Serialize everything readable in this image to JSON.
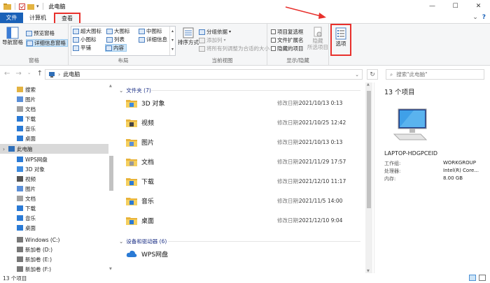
{
  "titlebar": {
    "title": "此电脑",
    "minimize": "—",
    "maximize": "☐",
    "close": "✕"
  },
  "tabs": {
    "file": "文件",
    "computer": "计算机",
    "view": "查看",
    "help_icon": "?"
  },
  "ribbon": {
    "pane_group": {
      "nav_pane": "导航窗格",
      "preview_pane": "预览窗格",
      "details_pane": "详细信息窗格",
      "label": "窗格"
    },
    "layout_group": {
      "items": [
        "超大图标",
        "大图标",
        "中图标",
        "小图标",
        "列表",
        "详细信息",
        "平铺",
        "内容"
      ],
      "label": "布局"
    },
    "current_view_group": {
      "sort_by": "排序方式",
      "group_by": "分组依据",
      "add_columns": "添加列",
      "fit_columns": "将所有列调整为合适的大小",
      "label": "当前视图"
    },
    "show_hide_group": {
      "item_checkboxes": "项目复选框",
      "file_extensions": "文件扩展名",
      "hidden_items": "隐藏的项目",
      "hide_selected_line1": "隐藏",
      "hide_selected_line2": "所选项目",
      "label": "显示/隐藏"
    },
    "options": "选项"
  },
  "address": {
    "path": "此电脑",
    "search_placeholder": "搜索\"此电脑\""
  },
  "nav_items": [
    {
      "label": "搜索",
      "icon": "folder-icon",
      "color": "#e3b341"
    },
    {
      "label": "图片",
      "icon": "pictures-icon",
      "color": "#5a8fd8"
    },
    {
      "label": "文档",
      "icon": "documents-icon",
      "color": "#a0a0a0"
    },
    {
      "label": "下载",
      "icon": "download-icon",
      "color": "#2a7ad5"
    },
    {
      "label": "音乐",
      "icon": "music-icon",
      "color": "#2a7ad5"
    },
    {
      "label": "桌面",
      "icon": "desktop-icon",
      "color": "#2a7ad5"
    },
    {
      "label": "此电脑",
      "icon": "computer-icon",
      "color": "#2f6fb8"
    },
    {
      "label": "WPS网盘",
      "icon": "cloud-icon",
      "color": "#2a7ad5"
    },
    {
      "label": "3D 对象",
      "icon": "3d-objects-icon",
      "color": "#3d8be0"
    },
    {
      "label": "视频",
      "icon": "videos-icon",
      "color": "#555555"
    },
    {
      "label": "图片",
      "icon": "pictures-icon",
      "color": "#5a8fd8"
    },
    {
      "label": "文档",
      "icon": "documents-icon",
      "color": "#a0a0a0"
    },
    {
      "label": "下载",
      "icon": "download-icon",
      "color": "#2a7ad5"
    },
    {
      "label": "音乐",
      "icon": "music-icon",
      "color": "#2a7ad5"
    },
    {
      "label": "桌面",
      "icon": "desktop-icon",
      "color": "#2a7ad5"
    },
    {
      "label": "Windows (C:)",
      "icon": "drive-icon",
      "color": "#777777"
    },
    {
      "label": "新加卷 (D:)",
      "icon": "drive-icon",
      "color": "#777777"
    },
    {
      "label": "新加卷 (E:)",
      "icon": "drive-icon",
      "color": "#777777"
    },
    {
      "label": "新加卷 (F:)",
      "icon": "drive-icon",
      "color": "#777777"
    }
  ],
  "folders_section": {
    "title": "文件夹 (7)"
  },
  "folders": [
    {
      "name": "3D 对象",
      "modified_label": "修改日期:",
      "modified": "2021/10/13 0:13",
      "badge": "3d"
    },
    {
      "name": "视频",
      "modified_label": "修改日期:",
      "modified": "2021/10/25 12:42",
      "badge": "video"
    },
    {
      "name": "图片",
      "modified_label": "修改日期:",
      "modified": "2021/10/13 0:13",
      "badge": "picture"
    },
    {
      "name": "文档",
      "modified_label": "修改日期:",
      "modified": "2021/11/29 17:57",
      "badge": "doc"
    },
    {
      "name": "下载",
      "modified_label": "修改日期:",
      "modified": "2021/12/10 11:17",
      "badge": "download"
    },
    {
      "name": "音乐",
      "modified_label": "修改日期:",
      "modified": "2021/11/5 14:00",
      "badge": "music"
    },
    {
      "name": "桌面",
      "modified_label": "修改日期:",
      "modified": "2021/12/10 9:04",
      "badge": "desktop"
    }
  ],
  "devices_section": {
    "title": "设备和驱动器 (6)"
  },
  "devices": [
    {
      "name": "WPS网盘"
    }
  ],
  "details": {
    "count": "13 个项目",
    "computer_name": "LAPTOP-HDGPCEID",
    "props": [
      {
        "label": "工作组:",
        "value": "WORKGROUP"
      },
      {
        "label": "处理器:",
        "value": "Intel(R) Core..."
      },
      {
        "label": "内存:",
        "value": "8.00 GB"
      }
    ]
  },
  "status": {
    "text": "13 个项目"
  },
  "colors": {
    "accent": "#1a61b8",
    "highlight": "#e8302c",
    "selected": "#cce4f7"
  }
}
